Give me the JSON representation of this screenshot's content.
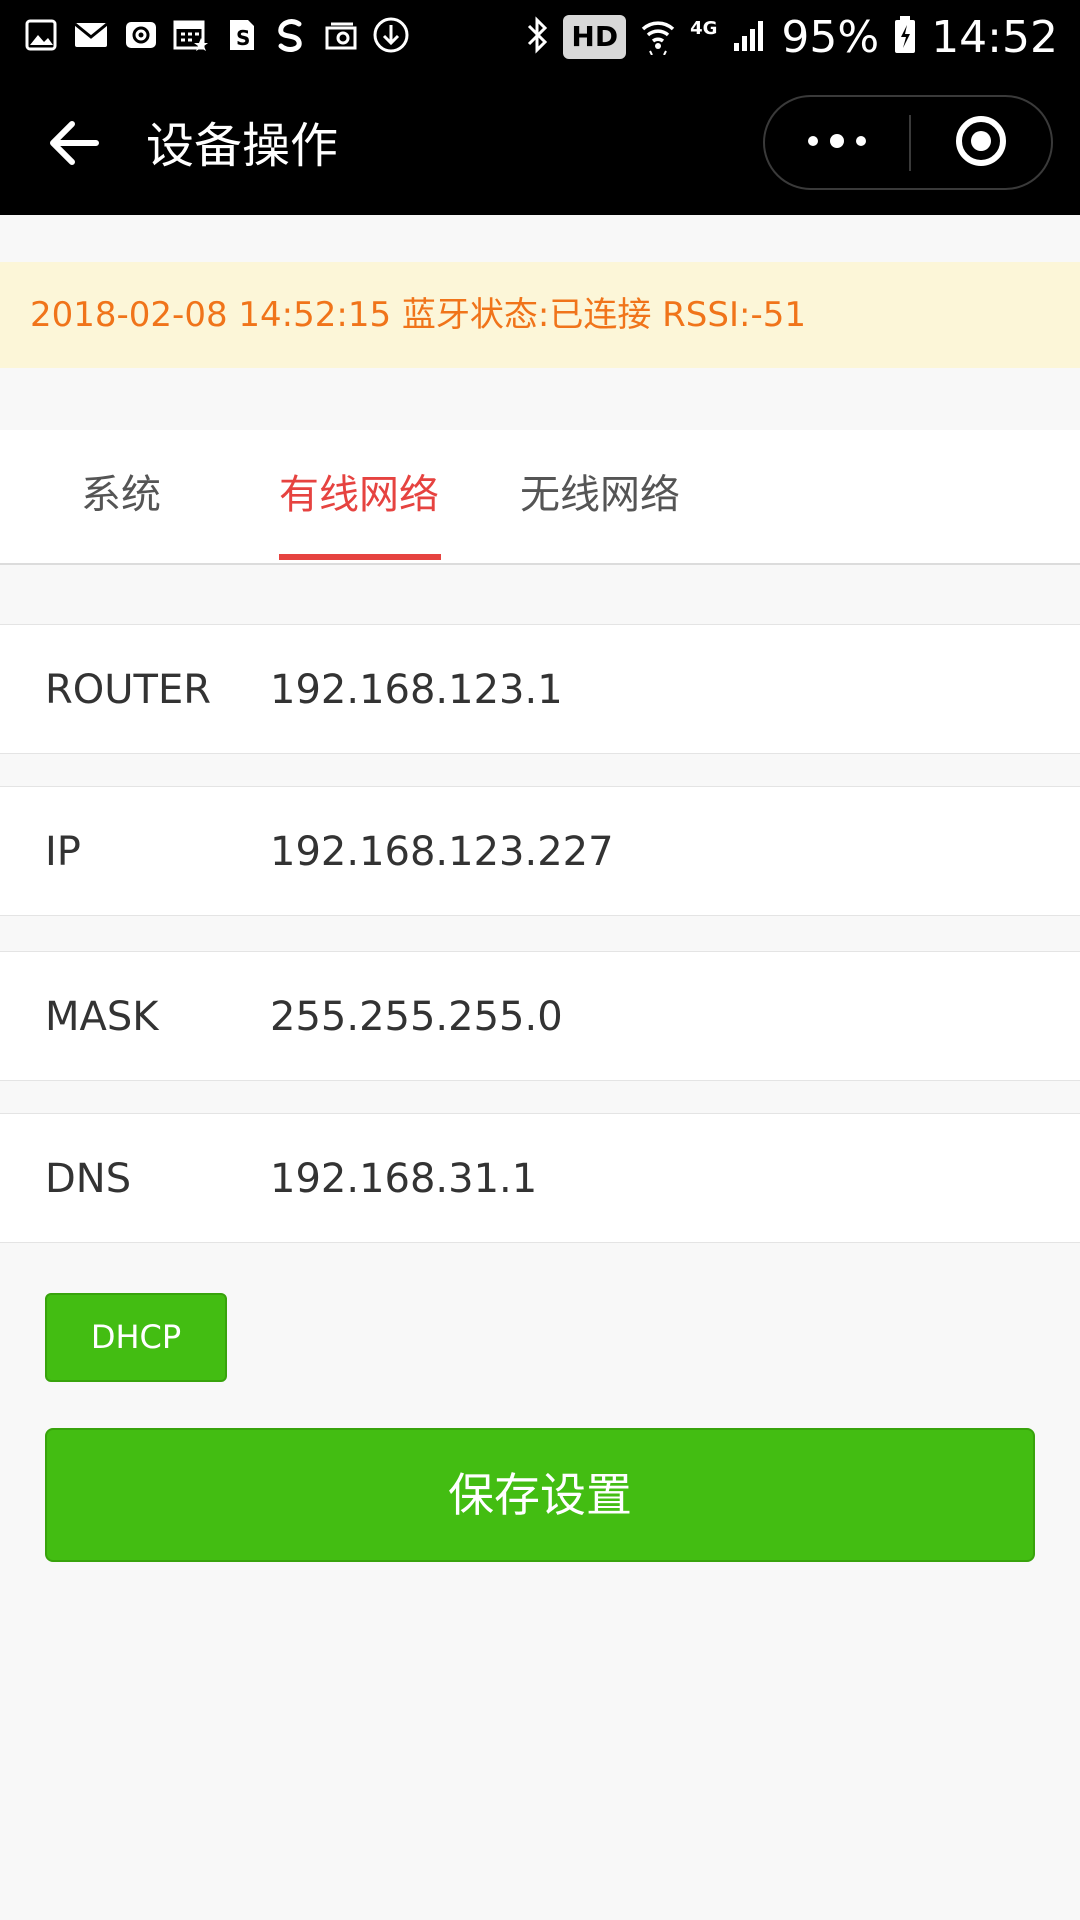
{
  "status_bar": {
    "hd_label": "HD",
    "network_label": "4G",
    "battery": "95%",
    "time": "14:52",
    "left_icons": [
      "gallery-icon",
      "mail-icon",
      "email-at-icon",
      "calendar-icon",
      "sim-icon",
      "weibo-icon",
      "mail-box-icon",
      "download-icon"
    ],
    "right_icons": [
      "bluetooth-icon",
      "wifi-icon",
      "signal-icon",
      "battery-icon"
    ]
  },
  "nav": {
    "title": "设备操作",
    "back_icon": "back-arrow-icon",
    "more_icon": "more-dots-icon",
    "close_icon": "target-close-icon"
  },
  "banner": {
    "text": "2018-02-08 14:52:15 蓝牙状态:已连接 RSSI:-51",
    "color": "#f0741a",
    "background": "#fcf6d8"
  },
  "tabs": {
    "items": [
      {
        "label": "系统",
        "active": false
      },
      {
        "label": "有线网络",
        "active": true
      },
      {
        "label": "无线网络",
        "active": false
      }
    ],
    "active_color": "#e64340"
  },
  "form": {
    "rows": [
      {
        "label": "ROUTER",
        "value": "192.168.123.1"
      },
      {
        "label": "IP",
        "value": "192.168.123.227"
      },
      {
        "label": "MASK",
        "value": "255.255.255.0"
      },
      {
        "label": "DNS",
        "value": "192.168.31.1"
      }
    ]
  },
  "buttons": {
    "dhcp_label": "DHCP",
    "save_label": "保存设置",
    "color": "#43bd12"
  }
}
